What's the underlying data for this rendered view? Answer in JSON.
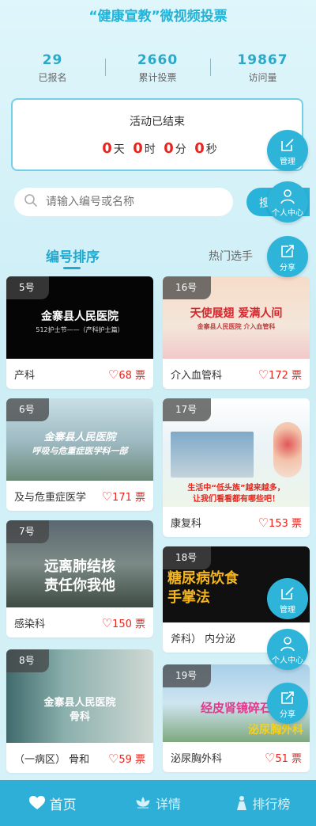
{
  "header": {
    "title": "“健康宣教”微视频投票"
  },
  "stats": [
    {
      "value": "29",
      "label": "已报名"
    },
    {
      "value": "2660",
      "label": "累计投票"
    },
    {
      "value": "19867",
      "label": "访问量"
    }
  ],
  "countdown": {
    "title": "活动已结束",
    "days": "0",
    "days_unit": "天",
    "hours": "0",
    "hours_unit": "时",
    "minutes": "0",
    "minutes_unit": "分",
    "seconds": "0",
    "seconds_unit": "秒"
  },
  "search": {
    "placeholder": "请输入编号或名称",
    "button_label": "搜"
  },
  "tabs": {
    "sort": "编号排序",
    "hot": "热门选手"
  },
  "fabs": {
    "manage": "管理",
    "profile": "个人中心",
    "share": "分享"
  },
  "cards": [
    {
      "badge": "5号",
      "thumb_line1": "金寨县人民医院",
      "thumb_line2": "512护士节——（产科护士篇）",
      "name": "产科",
      "votes": "68 票"
    },
    {
      "badge": "16号",
      "thumb_line1": "天使展翅 爱满人间",
      "thumb_line2": "金寨县人民医院 介入血管科",
      "name": "介入血管科",
      "votes": "172 票"
    },
    {
      "badge": "6号",
      "thumb_line1": "金寨县人民医院",
      "thumb_line2": "呼吸与危重症医学科一部",
      "name": "及与危重症医学",
      "votes": "171 票"
    },
    {
      "badge": "17号",
      "thumb_line1": "生活中“低头族”越来越多，",
      "thumb_line2": "让我们看看都有哪些吧！",
      "name": "康复科",
      "votes": "153 票"
    },
    {
      "badge": "7号",
      "thumb_line1": "远离肺结核",
      "thumb_line2": "责任你我他",
      "name": "感染科",
      "votes": "150 票"
    },
    {
      "badge": "18号",
      "thumb_line1": "糖尿病饮食",
      "thumb_line2": "手掌法",
      "name": "斧科） 内分泌",
      "votes": ""
    },
    {
      "badge": "8号",
      "thumb_line1": "金寨县人民医院",
      "thumb_line2": "骨科",
      "name": "（一病区） 骨和",
      "votes": "59 票"
    },
    {
      "badge": "19号",
      "thumb_line1": "经皮肾镜碎石",
      "thumb_line2": "泌尿胸外科",
      "name": "泌尿胸外科",
      "votes": "51 票"
    }
  ],
  "bottom_nav": [
    {
      "label": "首页"
    },
    {
      "label": "详情"
    },
    {
      "label": "排行榜"
    }
  ],
  "colors": {
    "accent": "#2ab3da",
    "red": "#e8251d",
    "nav": "#2dafd8"
  }
}
